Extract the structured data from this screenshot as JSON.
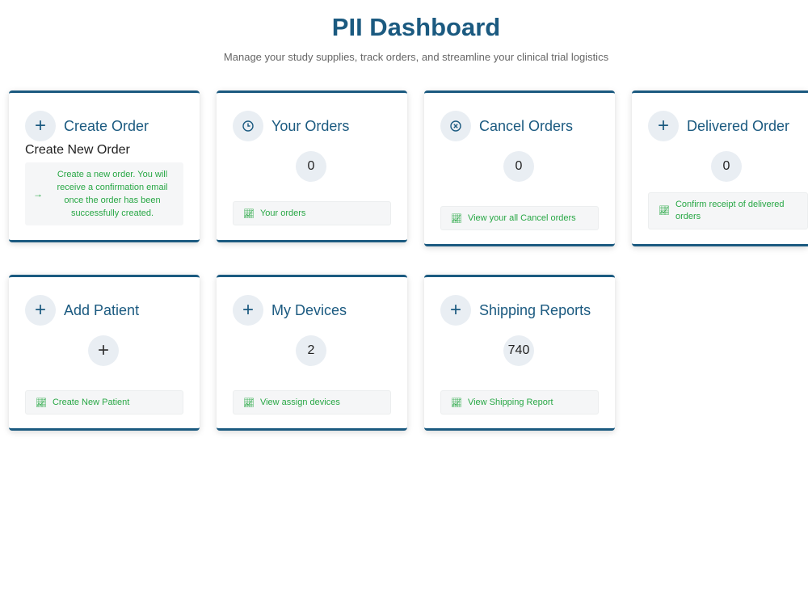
{
  "header": {
    "title": "PII Dashboard",
    "subtitle": "Manage your study supplies, track orders, and streamline your clinical trial logistics"
  },
  "cards": {
    "create_order": {
      "title": "Create Order",
      "icon": "plus-icon",
      "sub_heading": "Create New Order",
      "description": "Create a new order. You will receive a confirmation email once the order has been successfully created."
    },
    "your_orders": {
      "title": "Your Orders",
      "icon": "clock-icon",
      "count": "0",
      "action": "Your orders"
    },
    "cancel_orders": {
      "title": "Cancel Orders",
      "icon": "circle-x-icon",
      "count": "0",
      "action": "View your all Cancel orders"
    },
    "delivered_order": {
      "title": "Delivered Order",
      "icon": "plus-icon",
      "count": "0",
      "action": "Confirm receipt of delivered orders"
    },
    "add_patient": {
      "title": "Add Patient",
      "icon": "plus-icon",
      "count": "+",
      "action": "Create New Patient"
    },
    "my_devices": {
      "title": "My Devices",
      "icon": "plus-icon",
      "count": "2",
      "action": "View assign devices"
    },
    "shipping_reports": {
      "title": "Shipping Reports",
      "icon": "plus-icon",
      "count": "740",
      "action": "View Shipping Report"
    }
  },
  "colors": {
    "brand": "#1b5a80",
    "action_text": "#28a745",
    "circle_bg": "#e9eef3",
    "box_bg": "#f5f6f7"
  }
}
